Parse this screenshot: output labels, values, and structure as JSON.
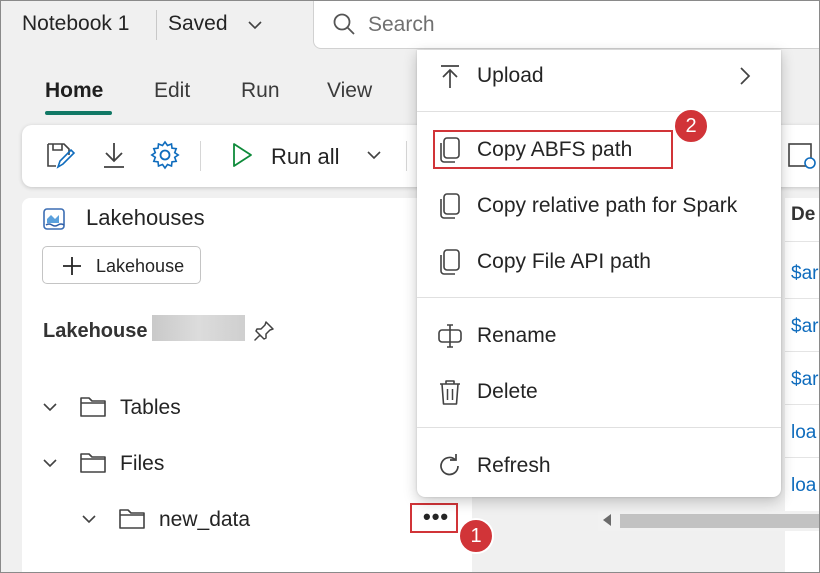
{
  "header": {
    "notebook_title": "Notebook 1",
    "save_status": "Saved",
    "search_placeholder": "Search"
  },
  "tabs": [
    {
      "label": "Home",
      "active": true
    },
    {
      "label": "Edit",
      "active": false
    },
    {
      "label": "Run",
      "active": false
    },
    {
      "label": "View",
      "active": false
    }
  ],
  "toolbar": {
    "run_all_label": "Run all"
  },
  "explorer": {
    "title": "Lakehouses",
    "add_button_label": "Lakehouse",
    "lakehouse_name": "Lakehouse",
    "tree": [
      {
        "label": "Tables",
        "level": 0
      },
      {
        "label": "Files",
        "level": 0
      },
      {
        "label": "new_data",
        "level": 1
      }
    ],
    "more_button_label": "•••"
  },
  "context_menu": {
    "items": [
      {
        "label": "Upload",
        "icon": "arrow-up-icon",
        "submenu": true
      },
      {
        "label": "Copy ABFS path",
        "icon": "copy-icon",
        "highlighted": true
      },
      {
        "label": "Copy relative path for Spark",
        "icon": "copy-icon"
      },
      {
        "label": "Copy File API path",
        "icon": "copy-icon"
      },
      {
        "label": "Rename",
        "icon": "rename-icon"
      },
      {
        "label": "Delete",
        "icon": "trash-icon"
      },
      {
        "label": "Refresh",
        "icon": "refresh-icon"
      }
    ]
  },
  "callouts": {
    "step1": "1",
    "step2": "2"
  },
  "right_table": {
    "header": "De",
    "rows": [
      "$ar",
      "$ar",
      "$ar",
      "loa",
      "loa"
    ]
  },
  "colors": {
    "accent": "#117865",
    "callout_red": "#d13438",
    "link_blue": "#0f6cbd",
    "run_green": "#0e8a3a"
  }
}
